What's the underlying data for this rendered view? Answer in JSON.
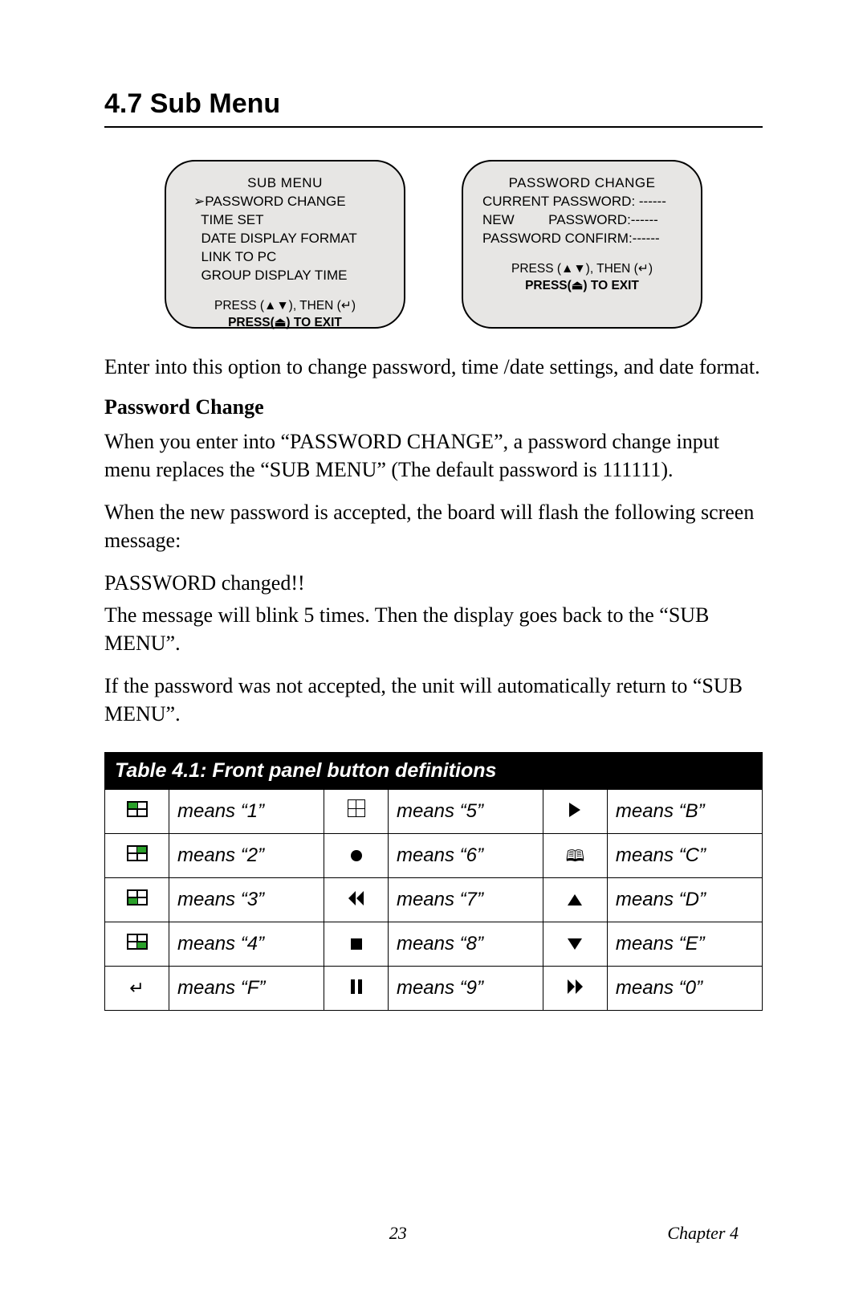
{
  "heading": "4.7  Sub Menu",
  "screen_left": {
    "title": "SUB MENU",
    "items": [
      "➢PASSWORD CHANGE",
      "  TIME SET",
      "  DATE DISPLAY FORMAT",
      "  LINK TO PC",
      "  GROUP DISPLAY TIME"
    ],
    "footer1": "PRESS (▲▼), THEN (↵)",
    "footer2": "PRESS(⏏) TO EXIT"
  },
  "screen_right": {
    "title": "PASSWORD CHANGE",
    "lines": [
      "CURRENT PASSWORD: ------",
      "NEW         PASSWORD:------",
      "PASSWORD CONFIRM:------"
    ],
    "footer1": "PRESS (▲▼), THEN (↵)",
    "footer2": "PRESS(⏏) TO EXIT"
  },
  "para1": "Enter into this option to change password, time /date settings, and date format.",
  "subhead1": "Password Change",
  "para2": "When you enter into “PASSWORD CHANGE”, a password change input menu replaces the “SUB MENU” The (default password is 111111).",
  "para2_fixed": "When you enter into “PASSWORD CHANGE”, a password change input menu replaces the “SUB MENU” (The default password is 111111).",
  "para3": "When the new password is accepted, the board will flash the following screen message:",
  "para4": "PASSWORD changed!!",
  "para5": "The message will blink 5 times. Then the display goes back to the “SUB MENU”.",
  "para6": "If the password was not accepted, the unit will automatically return to “SUB MENU”.",
  "table": {
    "caption": "Table 4.1: Front panel button definitions",
    "rows": [
      {
        "c1_icon": "quad-tl",
        "c1": "means “1”",
        "c2_icon": "grid9",
        "c2": "means “5”",
        "c3_icon": "tri-right",
        "c3": "means “B”"
      },
      {
        "c1_icon": "quad-tr",
        "c1": "means “2”",
        "c2_icon": "dot",
        "c2": "means “6”",
        "c3_icon": "book",
        "c3": "means “C”"
      },
      {
        "c1_icon": "quad-bl",
        "c1": "means “3”",
        "c2_icon": "dbl-left",
        "c2": "means “7”",
        "c3_icon": "tri-up",
        "c3": "means “D”"
      },
      {
        "c1_icon": "quad-br",
        "c1": "means “4”",
        "c2_icon": "square",
        "c2": "means “8”",
        "c3_icon": "tri-down",
        "c3": "means “E”"
      },
      {
        "c1_icon": "enter",
        "c1": "means “F”",
        "c2_icon": "pause",
        "c2": "means “9”",
        "c3_icon": "dbl-right",
        "c3": "means “0”"
      }
    ]
  },
  "footer": {
    "page": "23",
    "chapter": "Chapter 4"
  }
}
